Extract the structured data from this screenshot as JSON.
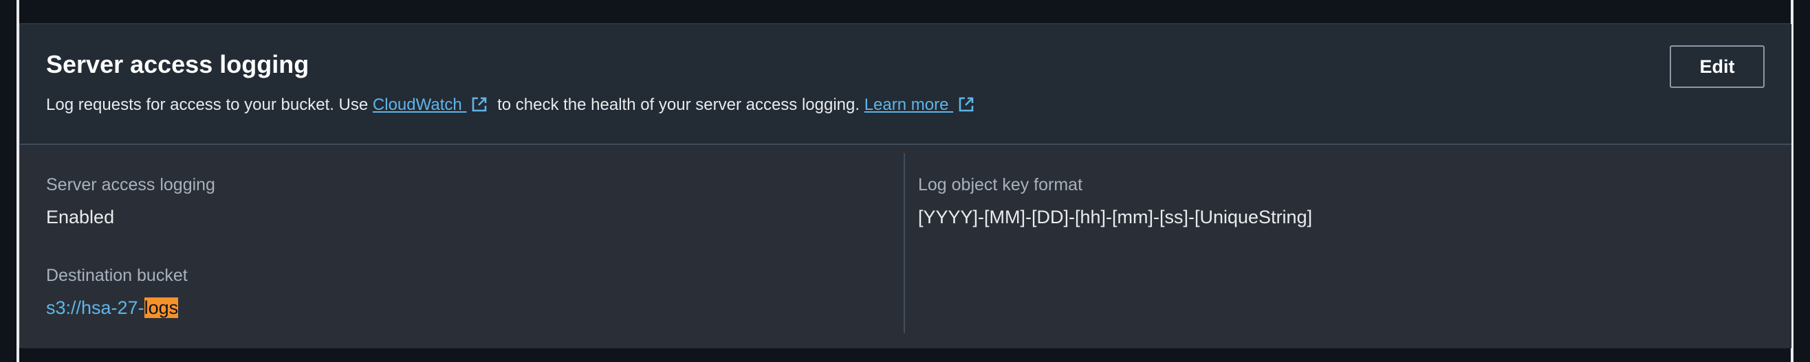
{
  "panel": {
    "title": "Server access logging",
    "description_part1": "Log requests for access to your bucket. Use ",
    "cloudwatch_link": "CloudWatch ",
    "description_part2": " to check the health of your server access logging. ",
    "learn_more_link": "Learn more ",
    "edit_label": "Edit"
  },
  "details": {
    "logging_label": "Server access logging",
    "logging_value": "Enabled",
    "destination_label": "Destination bucket",
    "destination_prefix": "s3://hsa-27-",
    "destination_highlight": "logs",
    "key_format_label": "Log object key format",
    "key_format_value": "[YYYY]-[MM]-[DD]-[hh]-[mm]-[ss]-[UniqueString]"
  },
  "icons": {
    "external": "external-link-icon"
  },
  "colors": {
    "link": "#5fb5e8",
    "highlight": "#f5922b",
    "panel_bg": "#232b35",
    "page_bg": "#0f141a"
  }
}
